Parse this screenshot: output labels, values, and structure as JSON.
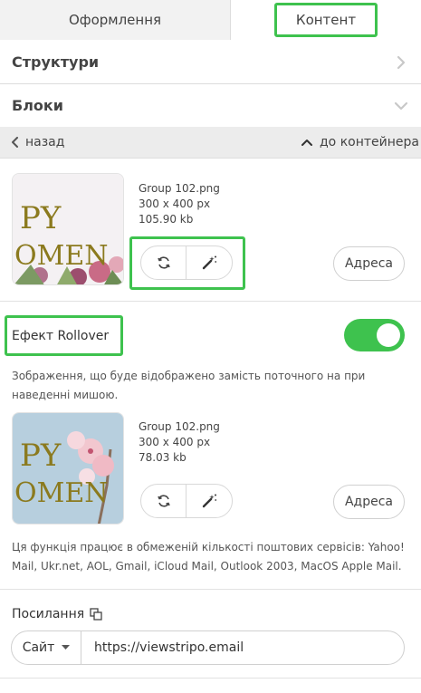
{
  "tabs": {
    "design": "Оформлення",
    "content": "Контент"
  },
  "sections": {
    "structures": "Структури",
    "blocks": "Блоки"
  },
  "nav": {
    "back": "назад",
    "to_container": "до контейнера"
  },
  "image1": {
    "filename": "Group 102.png",
    "dimensions": "300 x 400 px",
    "size": "105.90 kb",
    "caption_line1": "PY",
    "caption_line2": "OMEN"
  },
  "image2": {
    "filename": "Group 102.png",
    "dimensions": "300 x 400 px",
    "size": "78.03 kb",
    "caption_line1": "PY",
    "caption_line2": "OMEN"
  },
  "buttons": {
    "address": "Адреса"
  },
  "rollover": {
    "label": "Ефект Rollover",
    "enabled": true,
    "description": "Зображення, що буде відображено замість поточного на при наведенні мишою.",
    "note": "Ця функція працює в обмеженій кількості поштових сервісів: Yahoo! Mail, Ukr.net, AOL, Gmail, iCloud Mail, Outlook 2003, MacOS Apple Mail."
  },
  "link": {
    "label": "Посилання",
    "type": "Сайт",
    "url": "https://viewstripo.email"
  },
  "colors": {
    "accent": "#3ec24e",
    "nav_bg": "#ececec",
    "tab_inactive_bg": "#f2f2f2",
    "caption": "#8b7a1e"
  },
  "icons": [
    "chevron-right-icon",
    "chevron-down-icon",
    "chevron-left-icon",
    "chevron-up-icon",
    "refresh-icon",
    "magic-wand-icon",
    "copy-icon",
    "caret-down-icon"
  ]
}
